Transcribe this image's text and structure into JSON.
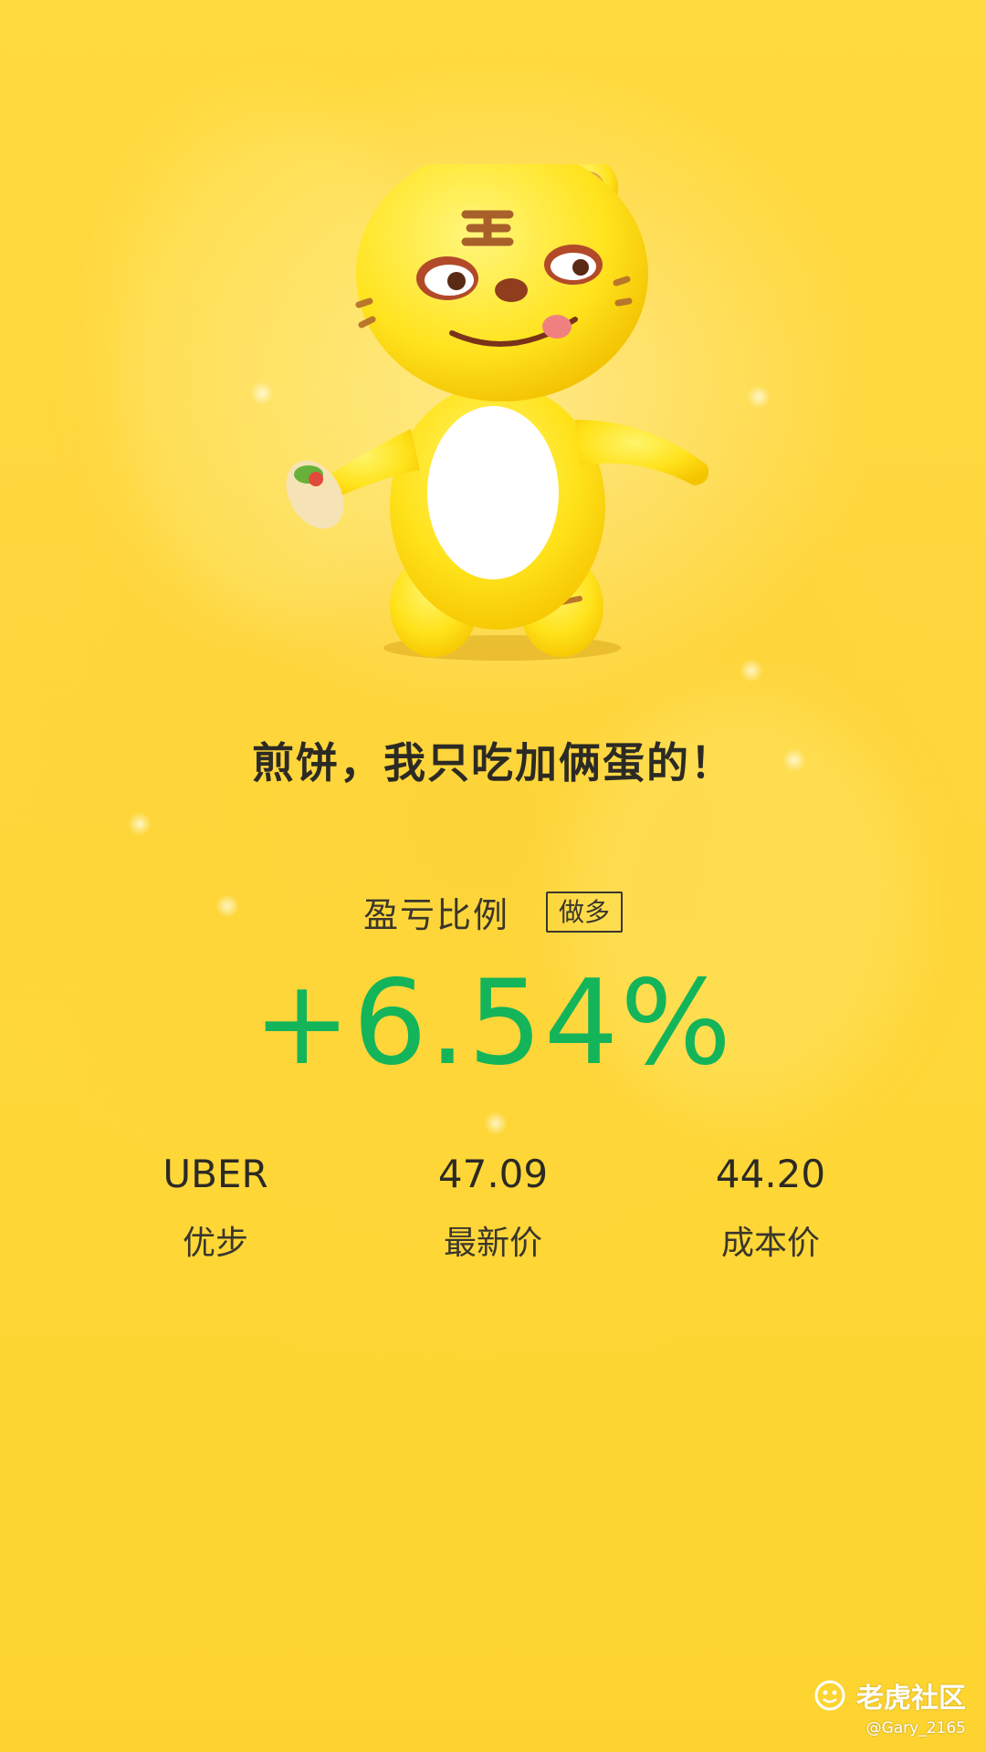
{
  "headline": "煎饼，我只吃加俩蛋的！",
  "position": {
    "ratio_label": "盈亏比例",
    "direction": "做多",
    "pnl_percent": "+6.54%"
  },
  "stats": [
    {
      "value": "UBER",
      "label": "优步"
    },
    {
      "value": "47.09",
      "label": "最新价"
    },
    {
      "value": "44.20",
      "label": "成本价"
    }
  ],
  "watermark": {
    "brand": "老虎社区",
    "user": "@Gary_2165"
  },
  "colors": {
    "background": "#ffd63d",
    "gain": "#14b45a",
    "text": "#2c2a24"
  },
  "mascot_icon": "tiger-mascot-icon"
}
